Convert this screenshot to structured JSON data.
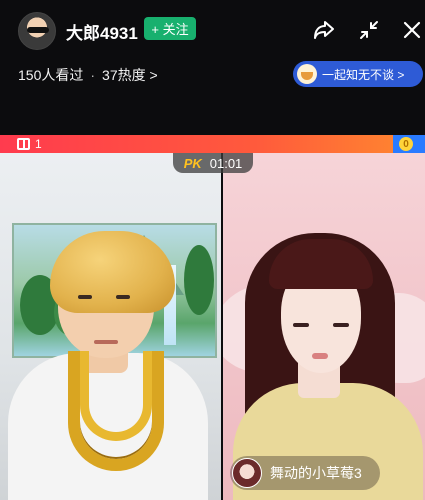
{
  "header": {
    "username": "大郎4931",
    "follow_label": "+ 关注",
    "viewers": "150人看过",
    "separator": "·",
    "heat": "37热度 >",
    "topic_pill": "一起知无不谈 >"
  },
  "pk": {
    "gift_count": "1",
    "label": "PK",
    "timer": "01:01",
    "coin_label": "0",
    "opponent_name": "舞动的小草莓3"
  },
  "colors": {
    "follow_green": "#18b06e",
    "pk_red": "#ff3b4e",
    "pk_blue": "#2a7bff",
    "topic_blue": "#2e5bd6"
  },
  "icons": [
    "share-icon",
    "minimize-icon",
    "close-icon",
    "gift-icon"
  ]
}
